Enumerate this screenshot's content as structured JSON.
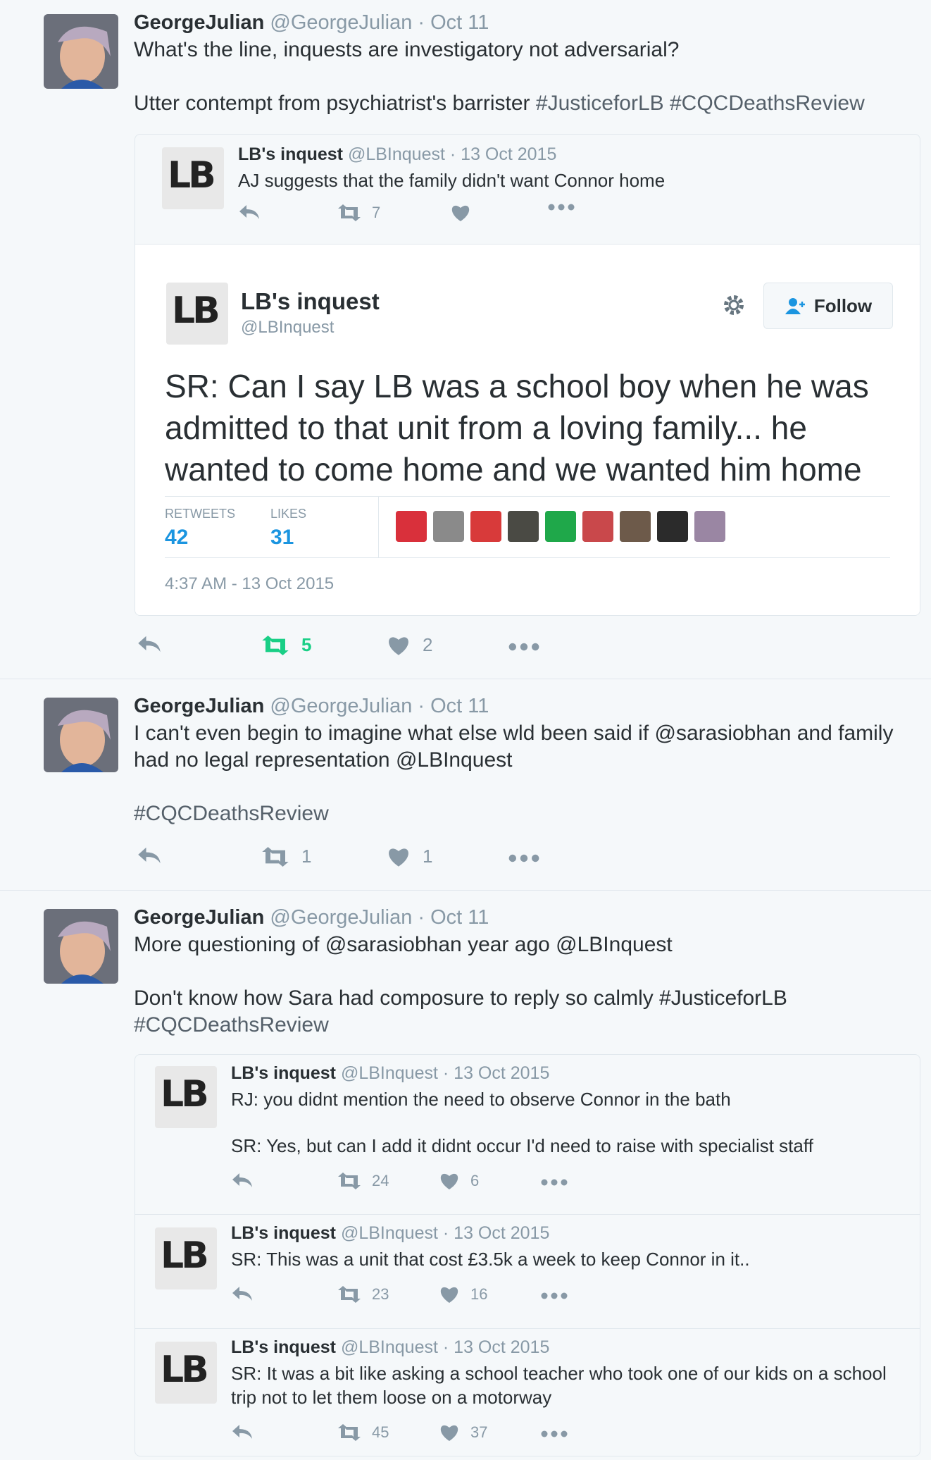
{
  "tweets": [
    {
      "user": {
        "name": "GeorgeJulian",
        "handle": "@GeorgeJulian",
        "date": "· Oct 11"
      },
      "line1": "What's the line, inquests are investigatory not adversarial?",
      "line2_text": "Utter contempt from psychiatrist's barrister ",
      "line2_tags": "#JusticeforLB #CQCDeathsReview",
      "quote": {
        "name": "LB's inquest",
        "handle": "@LBInquest",
        "date": "· 13 Oct 2015",
        "text": "AJ suggests that the family didn't want Connor home",
        "rt": "7"
      },
      "card": {
        "name": "LB's inquest",
        "handle": "@LBInquest",
        "follow": "Follow",
        "text": "SR: Can I say LB was a school boy when he was admitted to that unit from a loving family... he wanted to come home and we wanted him home",
        "retweets_label": "RETWEETS",
        "retweets": "42",
        "likes_label": "LIKES",
        "likes": "31",
        "time": "4:37 AM - 13 Oct 2015"
      },
      "rt": "5",
      "likes": "2"
    },
    {
      "user": {
        "name": "GeorgeJulian",
        "handle": "@GeorgeJulian",
        "date": "· Oct 11"
      },
      "line1": "I can't even begin to imagine what else wld been said if @sarasiobhan and family",
      "line1b": "had no legal representation @LBInquest",
      "tags": "#CQCDeathsReview",
      "rt": "1",
      "likes": "1"
    },
    {
      "user": {
        "name": "GeorgeJulian",
        "handle": "@GeorgeJulian",
        "date": "· Oct 11"
      },
      "line1": "More questioning of @sarasiobhan year ago @LBInquest",
      "line2": "Don't know how Sara had composure to reply so calmly #JusticeforLB",
      "line3": "#CQCDeathsReview",
      "quotes": [
        {
          "name": "LB's inquest",
          "handle": "@LBInquest",
          "date": "· 13 Oct 2015",
          "text1": "RJ: you didnt mention the need to observe Connor in the bath",
          "text2": "SR: Yes, but can I add it didnt occur I'd need to raise with specialist staff",
          "rt": "24",
          "likes": "6"
        },
        {
          "name": "LB's inquest",
          "handle": "@LBInquest",
          "date": "· 13 Oct 2015",
          "text1": "SR: This was a unit that cost £3.5k a week to keep Connor in it..",
          "rt": "23",
          "likes": "16"
        },
        {
          "name": "LB's inquest",
          "handle": "@LBInquest",
          "date": "· 13 Oct 2015",
          "text1": "SR: It was a bit like asking a school teacher who took one of our kids on a school",
          "text1b": "trip not to let them loose on a motorway",
          "rt": "45",
          "likes": "37"
        }
      ]
    }
  ],
  "icons": {
    "reply": "reply-icon",
    "retweet": "retweet-icon",
    "like": "heart-icon",
    "more": "more-icon",
    "gear": "gear-icon",
    "follow": "add-user-icon"
  },
  "colors": {
    "retweet_active": "#19cf86",
    "muted": "#8899a6",
    "stat": "#1b95e0"
  }
}
